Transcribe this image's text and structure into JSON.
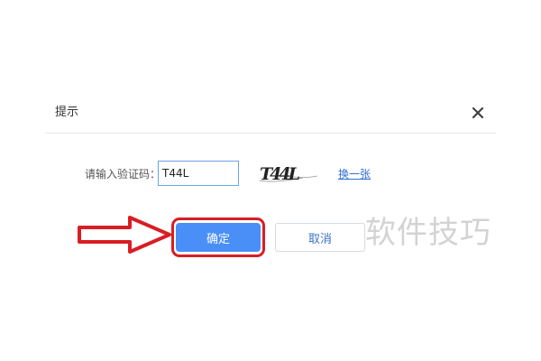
{
  "dialog": {
    "title": "提示",
    "close_icon": "close-icon"
  },
  "form": {
    "captcha_label": "请输入验证码：",
    "captcha_value": "T44L",
    "captcha_image_text": "T44L",
    "refresh_label": "换一张"
  },
  "buttons": {
    "ok_label": "确定",
    "cancel_label": "取消"
  },
  "annotation": {
    "arrow_icon": "right-arrow-icon",
    "highlight_color": "#d81e24"
  },
  "watermark": {
    "text": "软件技巧"
  },
  "colors": {
    "primary": "#4a8ff7",
    "link": "#2f6fd6"
  }
}
